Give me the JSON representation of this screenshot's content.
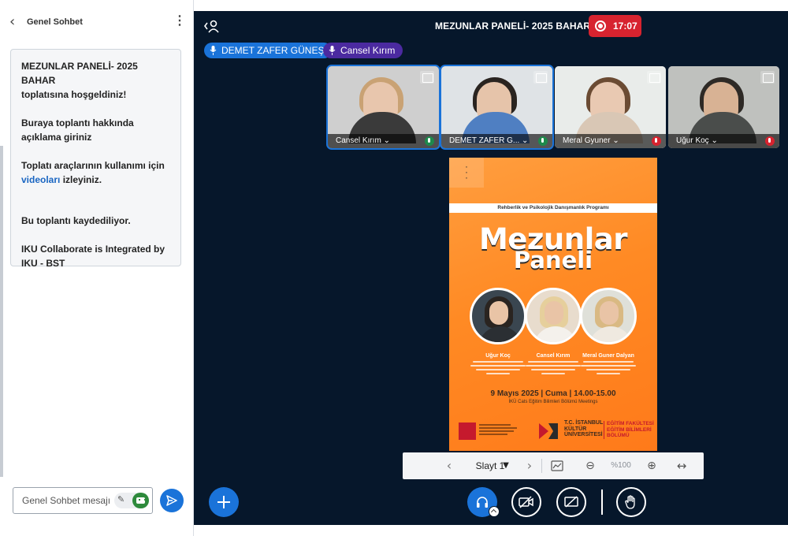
{
  "chat": {
    "title": "Genel Sohbet",
    "back_icon": "chevron-left-icon",
    "more_icon": "more-vertical-icon",
    "welcome": {
      "title_line": "MEZUNLAR PANELİ- 2025 BAHAR",
      "title_suffix": "toplatısına hoşgeldiniz!",
      "description": "Buraya toplantı hakkında açıklama giriniz",
      "tools_prefix": "Toplatı araçlarının kullanımı için",
      "tools_link": "videoları",
      "tools_suffix": "izleyiniz.",
      "recording_notice": "Bu toplantı kaydediliyor.",
      "integration": "IKU Collaborate is Integrated by IKU - BST"
    },
    "input_placeholder": "Genel Sohbet mesajı",
    "send_icon": "send-icon"
  },
  "meeting": {
    "title": "MEZUNLAR PANELİ- 2025 BAHAR",
    "recording_time": "17:07",
    "talkers": [
      "DEMET ZAFER GÜNEŞ",
      "Cansel Kırım"
    ],
    "tiles": [
      {
        "name": "Cansel Kırım ⌄",
        "mic": "on",
        "active": true
      },
      {
        "name": "DEMET ZAFER G... ⌄",
        "mic": "on",
        "active": true
      },
      {
        "name": "Meral Gyuner ⌄",
        "mic": "off",
        "active": false
      },
      {
        "name": "Uğur Koç ⌄",
        "mic": "off",
        "active": false
      }
    ]
  },
  "slide": {
    "program": "Rehberlik ve Psikolojik Danışmanlık Programı",
    "title_line1": "Mezunlar",
    "title_line2": "Paneli",
    "speakers": [
      "Uğur Koç",
      "Cansel Kırım",
      "Meral Guner Dalyan"
    ],
    "date": "9 Mayıs 2025 | Cuma | 14.00-15.00",
    "venue": "İKÜ Cats Eğitim Bilimleri Bölümü Meetings",
    "university": "T.C. İSTANBUL KÜLTÜR ÜNİVERSİTESİ",
    "faculty": "EĞİTİM FAKÜLTESİ EĞİTİM BİLİMLERİ BÖLÜMÜ"
  },
  "slide_controls": {
    "slide_label": "Slayt 1",
    "zoom": "%100",
    "prev_icon": "chevron-left-icon",
    "next_icon": "chevron-right-icon",
    "zoom_out_icon": "zoom-out-icon",
    "zoom_in_icon": "zoom-in-icon",
    "fit_icon": "fit-width-icon"
  },
  "colors": {
    "meeting_bg": "#06172b",
    "accent": "#1a73d9",
    "recording": "#d7232f",
    "slide_orange": "#ff8a24"
  }
}
